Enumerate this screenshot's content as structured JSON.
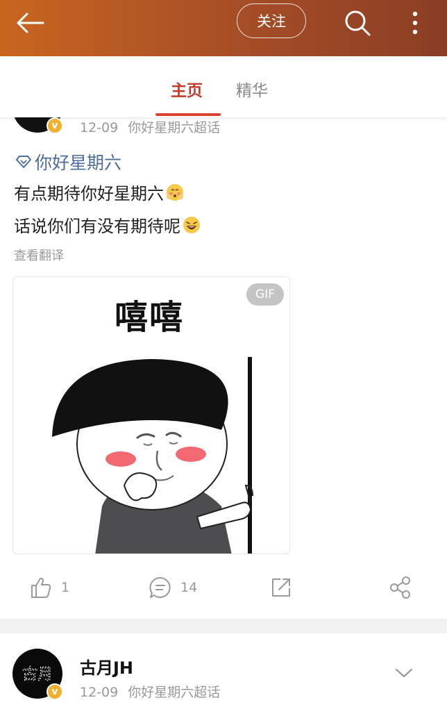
{
  "header": {
    "follow_label": "关注",
    "icons": [
      "back-arrow-icon",
      "search-icon",
      "more-vertical-icon"
    ],
    "gradient": [
      "#c8651f",
      "#8a3d24"
    ]
  },
  "tabs": [
    {
      "label": "主页",
      "active": true
    },
    {
      "label": "精华",
      "active": false
    }
  ],
  "post1": {
    "date": "12-09",
    "source": "你好星期六超话",
    "topic": "你好星期六",
    "lines": [
      "有点期待你好星期六",
      "话说你们有没有期待呢"
    ],
    "translate": "查看翻译",
    "gif_badge": "GIF",
    "gif_caption": "嘻嘻",
    "likes": "1",
    "comments": "14"
  },
  "post2": {
    "username": "古月JH",
    "date": "12-09",
    "source": "你好星期六超话",
    "avatar_text": "古月"
  },
  "colors": {
    "accent": "#c5382c",
    "topic": "#4b6d9c",
    "verified": "#f1b02d"
  }
}
